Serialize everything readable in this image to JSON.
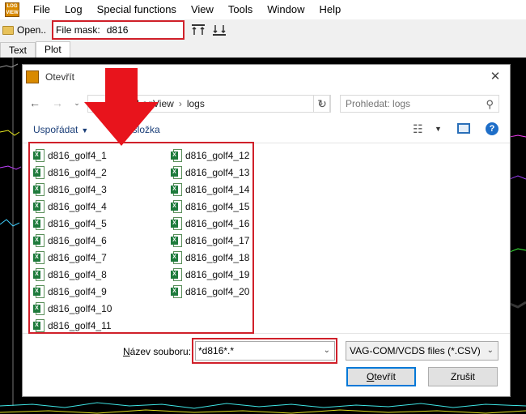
{
  "menubar": {
    "logo_text": "LOG VIEW",
    "items": [
      "File",
      "Log",
      "Special functions",
      "View",
      "Tools",
      "Window",
      "Help"
    ]
  },
  "toolbar": {
    "open_label": "Open..",
    "mask_label": "File mask:",
    "mask_value": "d816"
  },
  "tabs": [
    "Text",
    "Plot"
  ],
  "dialog": {
    "title": "Otevřít",
    "address": {
      "parent": "LogView",
      "current": "logs"
    },
    "search_placeholder": "Prohledat: logs",
    "organize_label": "Uspořádat",
    "new_folder_label": "ová složka",
    "files_col1": [
      "d816_golf4_1",
      "d816_golf4_2",
      "d816_golf4_3",
      "d816_golf4_4",
      "d816_golf4_5",
      "d816_golf4_6",
      "d816_golf4_7",
      "d816_golf4_8",
      "d816_golf4_9",
      "d816_golf4_10",
      "d816_golf4_11"
    ],
    "files_col2": [
      "d816_golf4_12",
      "d816_golf4_13",
      "d816_golf4_14",
      "d816_golf4_15",
      "d816_golf4_16",
      "d816_golf4_17",
      "d816_golf4_18",
      "d816_golf4_19",
      "d816_golf4_20"
    ],
    "filename_label_prefix": "N",
    "filename_label_rest": "ázev souboru:",
    "filename_value": "*d816*.*",
    "filter_value": "VAG-COM/VCDS files (*.CSV)",
    "open_button_prefix": "O",
    "open_button_rest": "tevřít",
    "cancel_button": "Zrušit"
  },
  "colors": {
    "highlight": "#d0202a",
    "plot_background": "#000000",
    "accent": "#0078d7"
  }
}
